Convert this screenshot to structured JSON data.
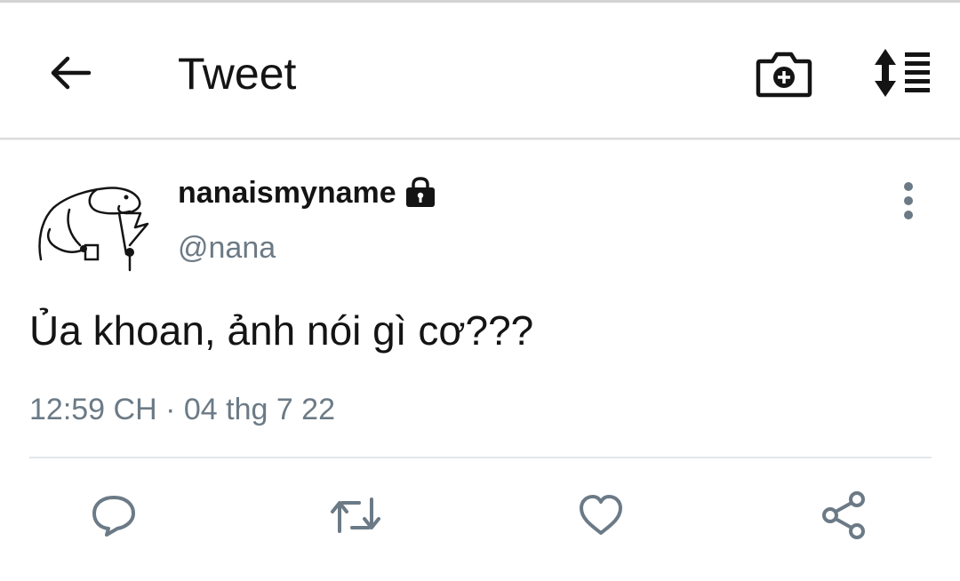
{
  "appbar": {
    "title": "Tweet",
    "icons": [
      "arrow-left-icon",
      "camera-plus-icon",
      "sort-list-icon"
    ]
  },
  "tweet": {
    "display_name": "nanaismyname",
    "handle": "@nana",
    "text": "Ủa khoan, ảnh nói gì cơ???",
    "timestamp": "12:59 CH · 04 thg 7 22",
    "protected_icon": "lock-icon"
  },
  "actions": [
    "reply-icon",
    "retweet-icon",
    "like-icon",
    "share-icon"
  ],
  "colors": {
    "text_primary": "#141414",
    "text_secondary": "#6b7a86",
    "icon_action": "#6b7a86",
    "divider": "#e3e6e8"
  }
}
